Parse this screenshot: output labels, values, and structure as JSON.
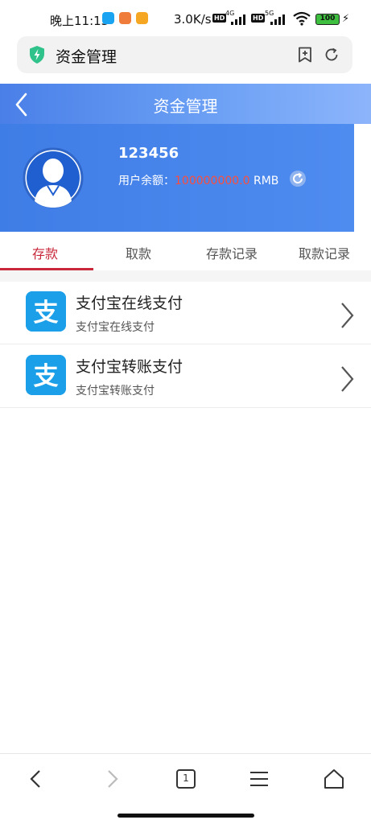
{
  "status_bar": {
    "time": "晚上11:13",
    "net_speed": "3.0K/s",
    "hd1": "HD",
    "sig1_label": "4G",
    "hd2": "HD",
    "sig2_label": "5G",
    "battery": "100"
  },
  "browser": {
    "title": "资金管理",
    "icons": [
      "shield-icon",
      "bookmark-add-icon",
      "reload-icon"
    ]
  },
  "header": {
    "title": "资金管理",
    "icons": [
      "back-icon"
    ]
  },
  "profile": {
    "user_id": "123456",
    "balance_label": "用户余额：",
    "balance_value": "100000000.0",
    "currency": "RMB"
  },
  "tabs": [
    {
      "label": "存款",
      "active": true
    },
    {
      "label": "取款",
      "active": false
    },
    {
      "label": "存款记录",
      "active": false
    },
    {
      "label": "取款记录",
      "active": false
    }
  ],
  "payments": [
    {
      "title": "支付宝在线支付",
      "subtitle": "支付宝在线支付",
      "logo_char": "支"
    },
    {
      "title": "支付宝转账支付",
      "subtitle": "支付宝转账支付",
      "logo_char": "支"
    }
  ],
  "bottom_nav": {
    "tab_count": "1",
    "icons": [
      "back-icon",
      "forward-icon",
      "tabs-icon",
      "menu-icon",
      "home-icon"
    ]
  },
  "colors": {
    "header_blue": "#4a7fe8",
    "accent_red": "#c8283a",
    "balance_red": "#ff4d3a",
    "alipay_blue": "#1a9fe8"
  }
}
